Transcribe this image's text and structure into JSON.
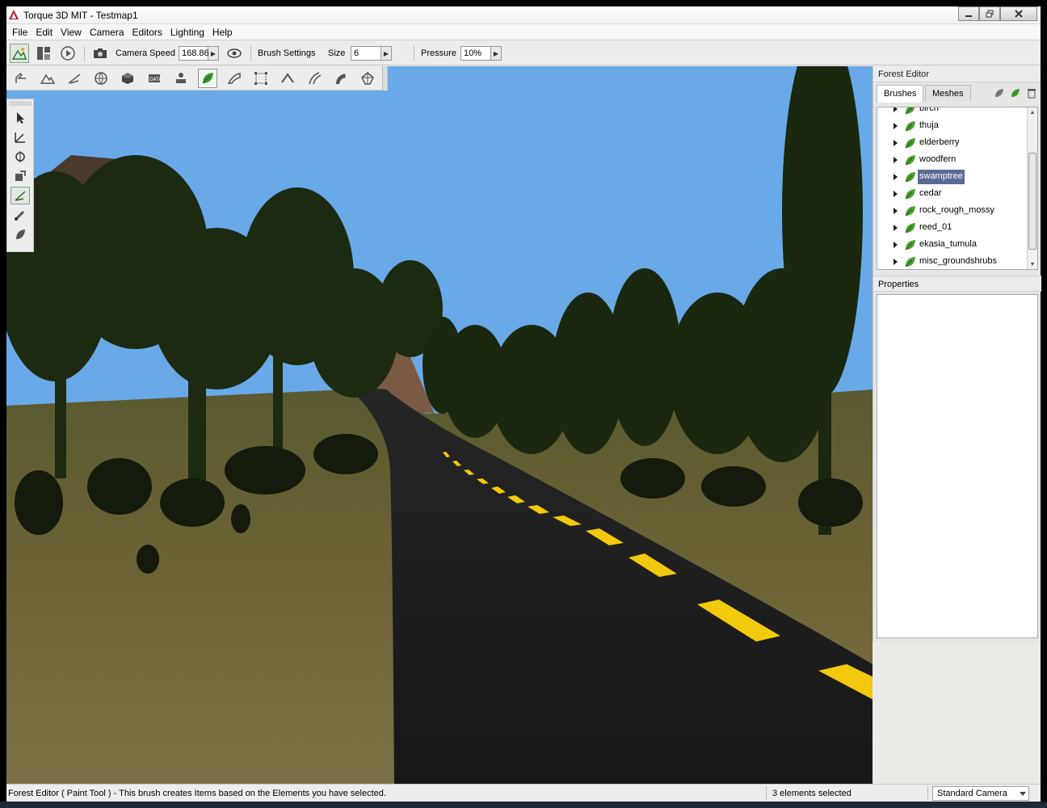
{
  "window": {
    "title": "Torque 3D MIT - Testmap1"
  },
  "menu": [
    "File",
    "Edit",
    "View",
    "Camera",
    "Editors",
    "Lighting",
    "Help"
  ],
  "toolbar": {
    "camera_speed_label": "Camera Speed",
    "camera_speed_value": "168.86",
    "brush_settings_label": "Brush Settings",
    "size_label": "Size",
    "size_value": "6",
    "pressure_label": "Pressure",
    "pressure_value": "10%"
  },
  "panel": {
    "title": "Forest Editor",
    "tabs": [
      "Brushes",
      "Meshes"
    ],
    "brushes": [
      {
        "label": "birch",
        "selected": false
      },
      {
        "label": "thuja",
        "selected": false
      },
      {
        "label": "elderberry",
        "selected": false
      },
      {
        "label": "woodfern",
        "selected": false
      },
      {
        "label": "swamptree",
        "selected": true
      },
      {
        "label": "cedar",
        "selected": false
      },
      {
        "label": "rock_rough_mossy",
        "selected": false
      },
      {
        "label": "reed_01",
        "selected": false
      },
      {
        "label": "ekasia_tumula",
        "selected": false
      },
      {
        "label": "misc_groundshrubs",
        "selected": false
      }
    ],
    "properties_title": "Properties"
  },
  "status": {
    "message": "Forest Editor ( Paint Tool ) - This brush creates Items based on the Elements you have selected.",
    "selection": "3 elements selected",
    "camera": "Standard Camera"
  },
  "colors": {
    "sky": "#69a9e8",
    "road": "#1b1b1c",
    "road_line": "#f2c90c",
    "selection": "#5a6a92"
  }
}
